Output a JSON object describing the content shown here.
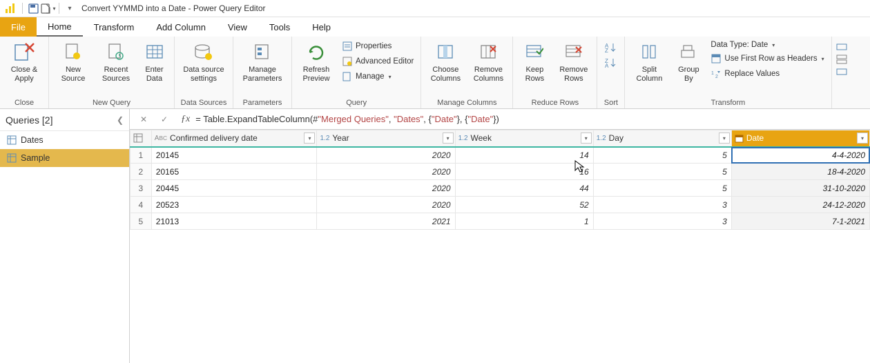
{
  "window_title": "Convert YYMMD into a Date - Power Query Editor",
  "menu": {
    "file": "File",
    "home": "Home",
    "transform": "Transform",
    "add_column": "Add Column",
    "view": "View",
    "tools": "Tools",
    "help": "Help"
  },
  "ribbon": {
    "close_apply": "Close &\nApply",
    "close_group": "Close",
    "new_source": "New\nSource",
    "recent_sources": "Recent\nSources",
    "enter_data": "Enter\nData",
    "new_query_group": "New Query",
    "data_source_settings": "Data source\nsettings",
    "data_sources_group": "Data Sources",
    "manage_parameters": "Manage\nParameters",
    "parameters_group": "Parameters",
    "refresh_preview": "Refresh\nPreview",
    "properties": "Properties",
    "advanced_editor": "Advanced Editor",
    "manage": "Manage",
    "query_group": "Query",
    "choose_columns": "Choose\nColumns",
    "remove_columns": "Remove\nColumns",
    "manage_columns_group": "Manage Columns",
    "keep_rows": "Keep\nRows",
    "remove_rows": "Remove\nRows",
    "reduce_rows_group": "Reduce Rows",
    "sort_group": "Sort",
    "split_column": "Split\nColumn",
    "group_by": "Group\nBy",
    "data_type": "Data Type: Date",
    "use_first_row": "Use First Row as Headers",
    "replace_values": "Replace Values",
    "transform_group": "Transform"
  },
  "queries_panel": {
    "title": "Queries [2]",
    "items": [
      "Dates",
      "Sample"
    ],
    "selected": 1
  },
  "formula": {
    "prefix": "= Table.ExpandTableColumn(#",
    "p1": "\"Merged Queries\"",
    "p2": ", ",
    "p3": "\"Dates\"",
    "p4": ", {",
    "p5": "\"Date\"",
    "p6": "}, {",
    "p7": "\"Date\"",
    "p8": "})"
  },
  "columns": {
    "c1": "Confirmed delivery date",
    "c2": "Year",
    "c3": "Week",
    "c4": "Day",
    "c5": "Date"
  },
  "rows": [
    {
      "n": "1",
      "c1": "20145",
      "c2": "2020",
      "c3": "14",
      "c4": "5",
      "c5": "4-4-2020"
    },
    {
      "n": "2",
      "c1": "20165",
      "c2": "2020",
      "c3": "16",
      "c4": "5",
      "c5": "18-4-2020"
    },
    {
      "n": "3",
      "c1": "20445",
      "c2": "2020",
      "c3": "44",
      "c4": "5",
      "c5": "31-10-2020"
    },
    {
      "n": "4",
      "c1": "20523",
      "c2": "2020",
      "c3": "52",
      "c4": "3",
      "c5": "24-12-2020"
    },
    {
      "n": "5",
      "c1": "21013",
      "c2": "2021",
      "c3": "1",
      "c4": "3",
      "c5": "7-1-2021"
    }
  ]
}
